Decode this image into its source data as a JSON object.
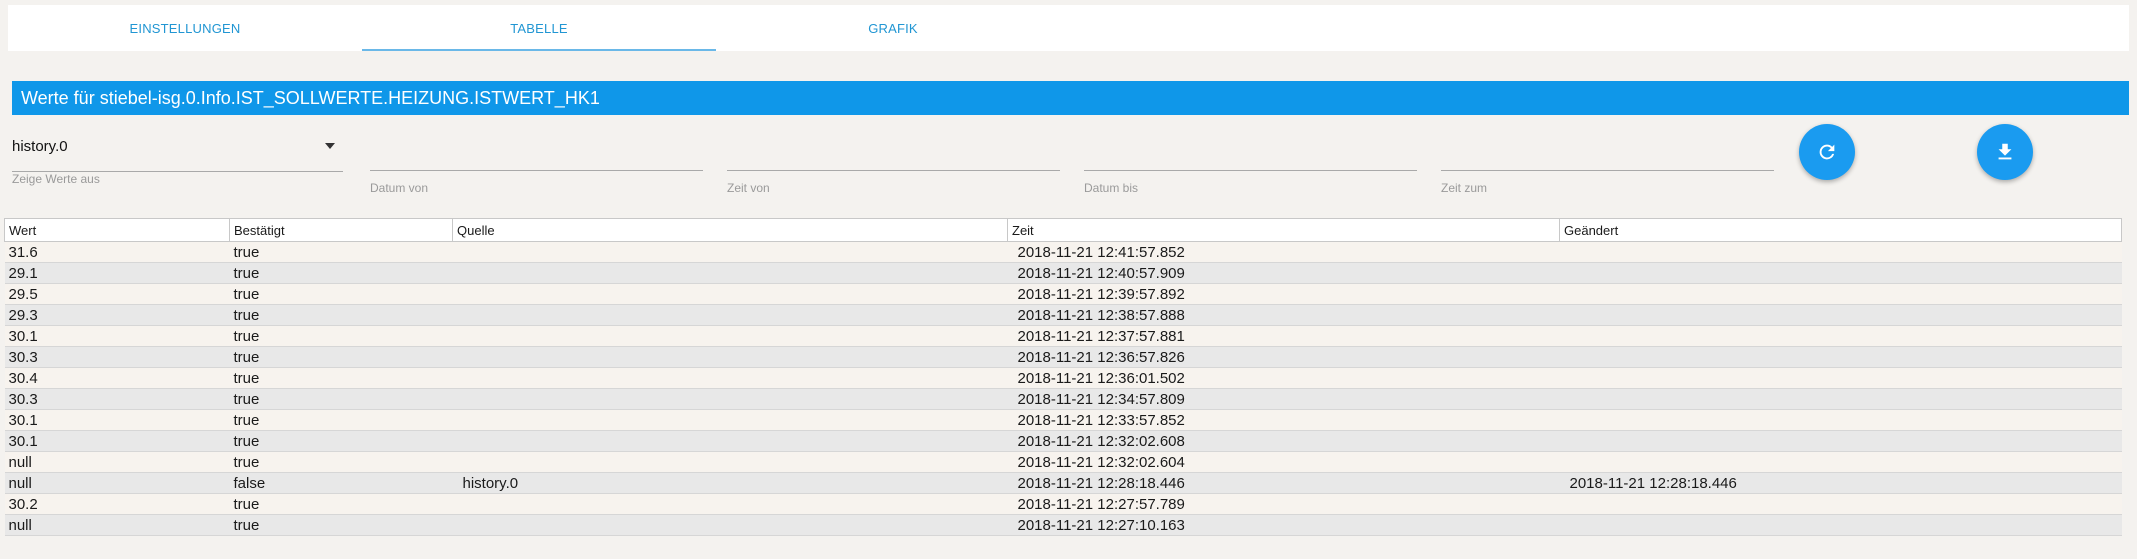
{
  "tabs": [
    {
      "label": "EINSTELLUNGEN"
    },
    {
      "label": "TABELLE"
    },
    {
      "label": "GRAFIK"
    }
  ],
  "header": {
    "title": "Werte für stiebel-isg.0.Info.IST_SOLLWERTE.HEIZUNG.ISTWERT_HK1"
  },
  "filters": {
    "instance": {
      "value": "history.0",
      "label": "Zeige Werte aus"
    },
    "date_from": {
      "value": "",
      "label": "Datum von"
    },
    "time_from": {
      "value": "",
      "label": "Zeit von"
    },
    "date_to": {
      "value": "",
      "label": "Datum bis"
    },
    "time_to": {
      "value": "",
      "label": "Zeit zum"
    }
  },
  "actions": {
    "refresh_icon": "refresh-icon",
    "download_icon": "download-icon"
  },
  "colors": {
    "accent": "#0f97e9",
    "tab_text": "#2196d3"
  },
  "table": {
    "columns": [
      "Wert",
      "Bestätigt",
      "Quelle",
      "Zeit",
      "Geändert"
    ],
    "rows": [
      [
        "31.6",
        "true",
        "",
        "2018-11-21 12:41:57.852",
        ""
      ],
      [
        "29.1",
        "true",
        "",
        "2018-11-21 12:40:57.909",
        ""
      ],
      [
        "29.5",
        "true",
        "",
        "2018-11-21 12:39:57.892",
        ""
      ],
      [
        "29.3",
        "true",
        "",
        "2018-11-21 12:38:57.888",
        ""
      ],
      [
        "30.1",
        "true",
        "",
        "2018-11-21 12:37:57.881",
        ""
      ],
      [
        "30.3",
        "true",
        "",
        "2018-11-21 12:36:57.826",
        ""
      ],
      [
        "30.4",
        "true",
        "",
        "2018-11-21 12:36:01.502",
        ""
      ],
      [
        "30.3",
        "true",
        "",
        "2018-11-21 12:34:57.809",
        ""
      ],
      [
        "30.1",
        "true",
        "",
        "2018-11-21 12:33:57.852",
        ""
      ],
      [
        "30.1",
        "true",
        "",
        "2018-11-21 12:32:02.608",
        ""
      ],
      [
        "null",
        "true",
        "",
        "2018-11-21 12:32:02.604",
        ""
      ],
      [
        "null",
        "false",
        "history.0",
        "2018-11-21 12:28:18.446",
        "2018-11-21 12:28:18.446"
      ],
      [
        "30.2",
        "true",
        "",
        "2018-11-21 12:27:57.789",
        ""
      ],
      [
        "null",
        "true",
        "",
        "2018-11-21 12:27:10.163",
        ""
      ]
    ]
  }
}
